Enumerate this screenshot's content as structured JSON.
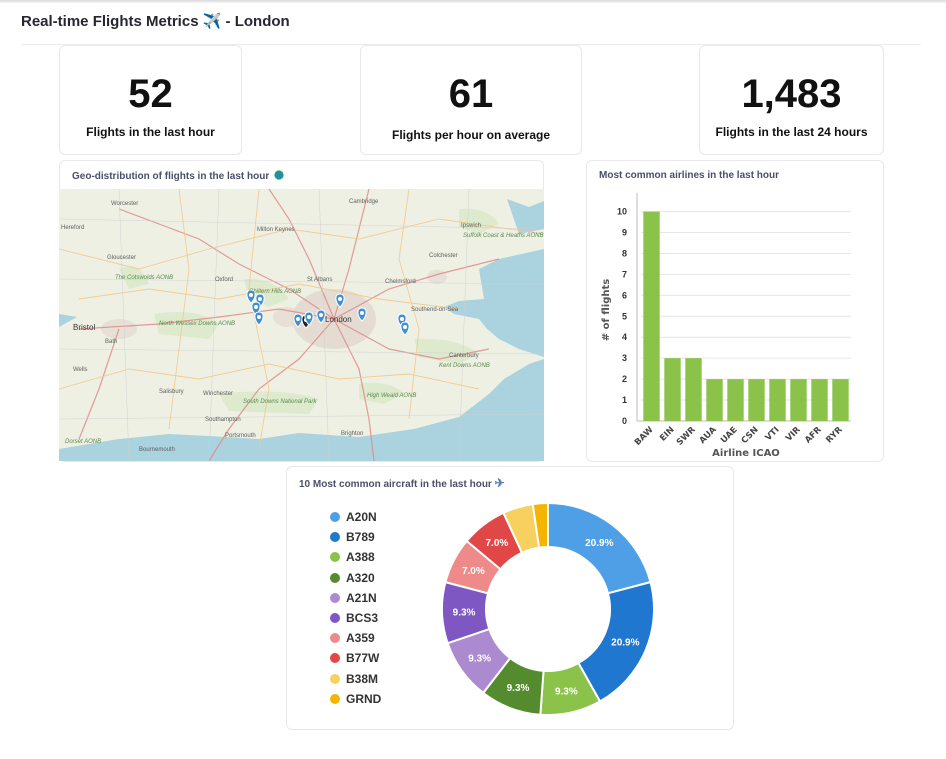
{
  "header": {
    "title": "Real-time Flights Metrics ✈️ - London"
  },
  "kpis": [
    {
      "value": "52",
      "label": "Flights in the last hour"
    },
    {
      "value": "61",
      "label": "Flights per hour on average"
    },
    {
      "value": "1,483",
      "label": "Flights in the last 24 hours"
    }
  ],
  "map_card": {
    "title": "Geo-distribution of flights in the last hour",
    "title_icon": "globe-icon",
    "places": [
      "Worcester",
      "Hereford",
      "Gloucester",
      "Oxford",
      "Cambridge",
      "Milton Keynes",
      "Ipswich",
      "St Albans",
      "Colchester",
      "Chelmsford",
      "London",
      "Southend-on-Sea",
      "Bristol",
      "Bath",
      "Wells",
      "Salisbury",
      "Winchester",
      "Southampton",
      "Portsmouth",
      "Brighton",
      "Canterbury",
      "Bournemouth",
      "The Cotswolds AONB",
      "North Wessex Downs AONB",
      "Chiltern Hills AONB",
      "South Downs National Park",
      "Kent Downs AONB",
      "High Weald AONB",
      "Dorset AONB",
      "Suffolk Coast & Heaths AONB"
    ]
  },
  "airlines_card": {
    "title": "Most common airlines in the last hour"
  },
  "aircraft_card": {
    "title": "10 Most common aircraft in the last hour",
    "title_icon": "airplane-icon"
  },
  "colors": {
    "bar": "#8bc34a",
    "donut": [
      "#4f9fe6",
      "#1f77d0",
      "#8bc34a",
      "#558b2f",
      "#ab8ad0",
      "#7e57c2",
      "#ef8a8a",
      "#e04848",
      "#f8d060",
      "#f5b400"
    ]
  },
  "chart_data": [
    {
      "type": "bar",
      "categories": [
        "BAW",
        "EIN",
        "SWR",
        "AUA",
        "UAE",
        "CSN",
        "VTI",
        "VIR",
        "AFR",
        "RYR"
      ],
      "values": [
        10,
        3,
        3,
        2,
        2,
        2,
        2,
        2,
        2,
        2
      ],
      "xlabel": "Airline ICAO",
      "ylabel": "# of flights",
      "yticks": [
        0,
        1,
        2,
        3,
        4,
        5,
        6,
        7,
        8,
        9,
        10
      ],
      "ylim": [
        0,
        10.6
      ],
      "grid": true
    },
    {
      "type": "pie",
      "donut": true,
      "categories": [
        "A20N",
        "B789",
        "A388",
        "A320",
        "A21N",
        "BCS3",
        "A359",
        "B77W",
        "B38M",
        "GRND"
      ],
      "values": [
        20.9,
        20.9,
        9.3,
        9.3,
        9.3,
        9.3,
        7.0,
        7.0,
        4.6,
        2.3
      ],
      "data_labels": [
        "20.9%",
        "20.9%",
        "9.3%",
        "9.3%",
        "9.3%",
        "9.3%",
        "7.0%",
        "7.0%",
        "",
        ""
      ],
      "legend": "left"
    }
  ]
}
